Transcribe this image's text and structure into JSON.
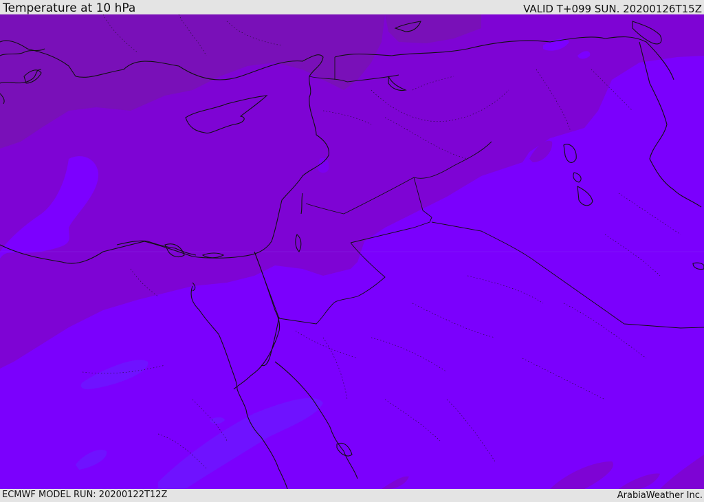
{
  "header": {
    "title": "Temperature at 10 hPa",
    "valid": "VALID T+099 SUN. 20200126T15Z"
  },
  "footer": {
    "model_run": "ECMWF MODEL RUN: 20200122T12Z",
    "credit": "ArabiaWeather Inc."
  },
  "map": {
    "field": "temperature",
    "level": "10 hPa",
    "region": "Eastern Mediterranean / Middle East",
    "colors": {
      "darkest": "#7910b8",
      "dark": "#7e04d4",
      "mid": "#7c00e8",
      "base": "#7b00fd",
      "light": "#6f12ff",
      "accent_patch": "#6a00d8"
    }
  }
}
